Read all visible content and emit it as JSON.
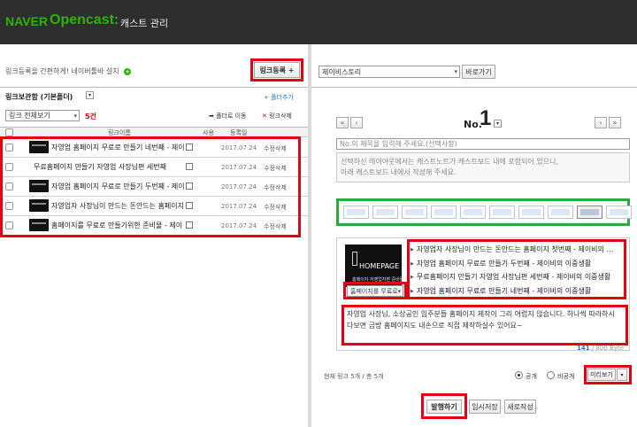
{
  "header": {
    "brand_naver": "NAVER",
    "brand_opencast": "Opencast:",
    "page_title": "캐스트 관리"
  },
  "left": {
    "guide_text": "링크등록을 간편하게! 네이버툴바 설치",
    "register_button": "링크등록 +",
    "storage_title": "링크보관함 (기본폴더)",
    "add_folder": "폴더추가",
    "view_select": "링크 전체보기",
    "count": "5건",
    "move_folder": "폴더로 이동",
    "delete_link": "링크삭제",
    "columns": {
      "name": "링크이름",
      "use": "사용",
      "date": "등록일"
    },
    "rows": [
      {
        "title": "자영업 홈페이지 무료로 만들기 네번째 - 제이",
        "date": "2017.07.24",
        "actions": "수정삭제"
      },
      {
        "title": "무료홈페이지 만들기 자영업 사장님편 세번째",
        "date": "2017.07.24",
        "actions": "수정삭제"
      },
      {
        "title": "자영업 홈페이지 무료로 만들기 두번째 - 제이",
        "date": "2017.07.24",
        "actions": "수정삭제"
      },
      {
        "title": "자영업자 사장님이 만드는 돈안드는 홈페이지",
        "date": "2017.07.24",
        "actions": "수정삭제"
      },
      {
        "title": "홈페이지를 무료로 만들기위한 준비물 - 제이",
        "date": "2017.07.24",
        "actions": "수정삭제"
      }
    ]
  },
  "right": {
    "cast_select": "제이비스토리",
    "go_button": "바로가기",
    "no_label": "No.",
    "no_value": "1",
    "title_placeholder": "No.의 제목을 입력해 주세요.(선택사항)",
    "notice_line1": "선택하신 레이아웃에서는 캐스트노트가 캐스트보드 내에 포함되어 있으니,",
    "notice_line2": "아래 캐스트보드 내에서 작성해 주세요.",
    "layout_count": 10,
    "layout_active_index": 8,
    "card": {
      "thumb_text": "HOMEPAGE",
      "thumb_sub": "홈페이지 자영업자편 준비물",
      "thumb_select": "홈페이지를 무료로",
      "items": [
        "자영업자 사장님이 만드는 돈안드는 홈페이지 첫번째 - 제이비의 …",
        "자영업 홈페이지 무료로 만들기 두번째 - 제이비의 이중생활",
        "무료홈페이지 만들기 자영업 사장님편 세번째 - 제이비의 이중생활",
        "자영업 홈페이지 무료로 만들기 네번째 - 제이비의 이중생활"
      ],
      "note_text": "자영업 사장님, 소상공인 입주분들 홈페이지 제작이 그리 어렵지 않습니다. 하나씩 따라하시다보면 금방 홈페이지도 내손으로 직접 제작하실수 있어요~",
      "byte_count": "141",
      "byte_total": "/ 800 Byte"
    },
    "status_text": "현재 링크 5개 / 총 5개",
    "public_label": "공개",
    "private_label": "비공개",
    "preview_button": "미리보기",
    "publish_button": "발행하기",
    "temp_save_button": "임시저장",
    "new_write_button": "새로작성"
  }
}
